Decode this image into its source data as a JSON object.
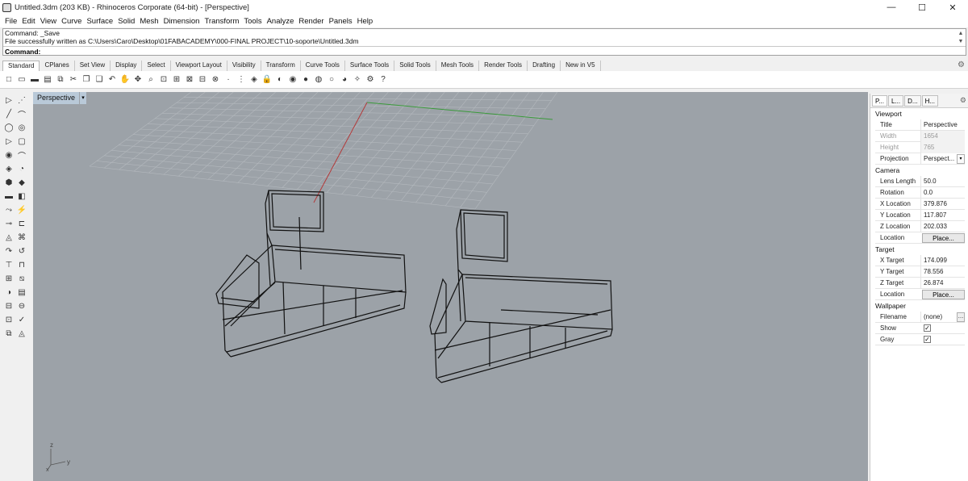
{
  "window": {
    "title": "Untitled.3dm (203 KB) - Rhinoceros Corporate (64-bit) - [Perspective]",
    "minimize_glyph": "—",
    "maximize_glyph": "☐",
    "close_glyph": "✕"
  },
  "menu": [
    "File",
    "Edit",
    "View",
    "Curve",
    "Surface",
    "Solid",
    "Mesh",
    "Dimension",
    "Transform",
    "Tools",
    "Analyze",
    "Render",
    "Panels",
    "Help"
  ],
  "command": {
    "history": [
      "Command: _Save",
      "File successfully written as C:\\Users\\Caro\\Desktop\\01FABACADEMY\\000-FINAL PROJECT\\10-soporte\\Untitled.3dm"
    ],
    "prompt_label": "Command:",
    "input_value": ""
  },
  "toolbar_tabs": [
    "Standard",
    "CPlanes",
    "Set View",
    "Display",
    "Select",
    "Viewport Layout",
    "Visibility",
    "Transform",
    "Curve Tools",
    "Surface Tools",
    "Solid Tools",
    "Mesh Tools",
    "Render Tools",
    "Drafting",
    "New in V5"
  ],
  "active_toolbar_tab": "Standard",
  "toolbar_icons": [
    "new-file-icon",
    "open-file-icon",
    "save-icon",
    "print-icon",
    "import-icon",
    "cut-icon",
    "copy-icon",
    "paste-icon",
    "undo-icon",
    "pan-icon",
    "rotate-view-icon",
    "zoom-icon",
    "zoom-window-icon",
    "zoom-extents-icon",
    "zoom-selected-icon",
    "four-viewports-icon",
    "cplane-icon",
    "point-icon",
    "grid-snap-icon",
    "select-icon",
    "lock-icon",
    "layer-icon",
    "color-wheel-icon",
    "shaded-icon",
    "rendered-icon",
    "ghosted-icon",
    "render-icon",
    "light-icon",
    "options-icon",
    "help-icon"
  ],
  "toolbar_glyphs": [
    "□",
    "▭",
    "▬",
    "▤",
    "⧉",
    "✂",
    "❐",
    "❏",
    "↶",
    "✋",
    "✥",
    "⌕",
    "⊡",
    "⊞",
    "⊠",
    "⊟",
    "⊗",
    "·",
    "⋮",
    "◈",
    "🔒",
    "◐",
    "◉",
    "●",
    "◍",
    "○",
    "◕",
    "✧",
    "⚙",
    "?"
  ],
  "left_tool_glyphs": [
    [
      "▷",
      "⋰"
    ],
    [
      "╱",
      "⌒"
    ],
    [
      "◯",
      "◎"
    ],
    [
      "▷",
      "▢"
    ],
    [
      "◉",
      "⌒"
    ],
    [
      "◈",
      "◔"
    ],
    [
      "⬢",
      "◆"
    ],
    [
      "▬",
      "◧"
    ],
    [
      "⤳",
      "⚡"
    ],
    [
      "⊸",
      "⊏"
    ],
    [
      "◬",
      "⌘"
    ],
    [
      "↷",
      "↺"
    ],
    [
      "⊤",
      "⊓"
    ],
    [
      "⊞",
      "⧅"
    ],
    [
      "◑",
      "▤"
    ],
    [
      "⊟",
      "⊖"
    ],
    [
      "⊡",
      "✓"
    ],
    [
      "⧉",
      "◬"
    ]
  ],
  "viewport": {
    "label": "Perspective",
    "dropdown_glyph": "▾",
    "axis_labels": {
      "z": "z",
      "x": "x",
      "y": "y"
    }
  },
  "panel": {
    "tabs": [
      "P...",
      "L...",
      "D...",
      "H..."
    ],
    "sections": {
      "viewport_title": "Viewport",
      "camera_title": "Camera",
      "target_title": "Target",
      "wallpaper_title": "Wallpaper"
    },
    "viewport": [
      {
        "label": "Title",
        "value": "Perspective",
        "dim": false
      },
      {
        "label": "Width",
        "value": "1654",
        "dim": true
      },
      {
        "label": "Height",
        "value": "765",
        "dim": true
      },
      {
        "label": "Projection",
        "value": "Perspect...",
        "dim": false
      }
    ],
    "camera": [
      {
        "label": "Lens Length",
        "value": "50.0"
      },
      {
        "label": "Rotation",
        "value": "0.0"
      },
      {
        "label": "X Location",
        "value": "379.876"
      },
      {
        "label": "Y Location",
        "value": "117.807"
      },
      {
        "label": "Z Location",
        "value": "202.033"
      }
    ],
    "camera_location_label": "Location",
    "camera_location_button": "Place...",
    "target": [
      {
        "label": "X Target",
        "value": "174.099"
      },
      {
        "label": "Y Target",
        "value": "78.556"
      },
      {
        "label": "Z Target",
        "value": "26.874"
      }
    ],
    "target_location_label": "Location",
    "target_location_button": "Place...",
    "wallpaper": {
      "filename_label": "Filename",
      "filename_value": "(none)",
      "show_label": "Show",
      "gray_label": "Gray",
      "check_glyph": "✓"
    }
  },
  "colors": {
    "viewport_bg": "#9ca2a8",
    "grid": "#b4b9be",
    "x_axis": "#b33a3a",
    "y_axis": "#3a9a3a"
  }
}
